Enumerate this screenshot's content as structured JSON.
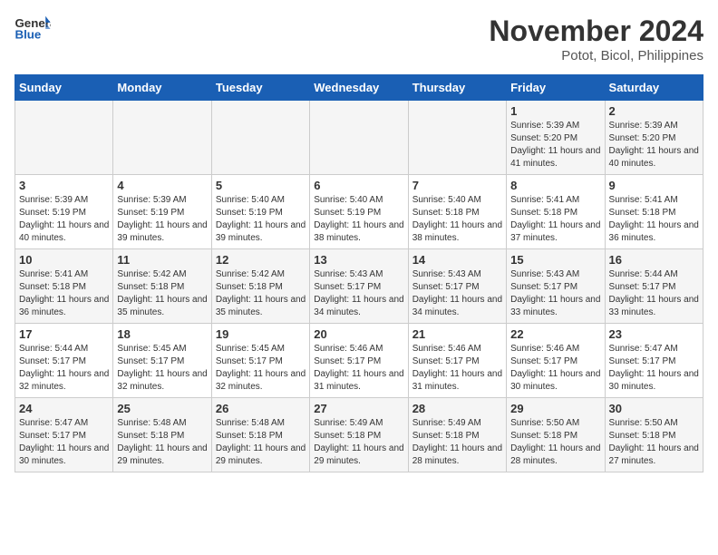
{
  "header": {
    "logo_line1": "General",
    "logo_line2": "Blue",
    "month": "November 2024",
    "location": "Potot, Bicol, Philippines"
  },
  "days_of_week": [
    "Sunday",
    "Monday",
    "Tuesday",
    "Wednesday",
    "Thursday",
    "Friday",
    "Saturday"
  ],
  "weeks": [
    [
      {
        "day": "",
        "info": ""
      },
      {
        "day": "",
        "info": ""
      },
      {
        "day": "",
        "info": ""
      },
      {
        "day": "",
        "info": ""
      },
      {
        "day": "",
        "info": ""
      },
      {
        "day": "1",
        "info": "Sunrise: 5:39 AM\nSunset: 5:20 PM\nDaylight: 11 hours and 41 minutes."
      },
      {
        "day": "2",
        "info": "Sunrise: 5:39 AM\nSunset: 5:20 PM\nDaylight: 11 hours and 40 minutes."
      }
    ],
    [
      {
        "day": "3",
        "info": "Sunrise: 5:39 AM\nSunset: 5:19 PM\nDaylight: 11 hours and 40 minutes."
      },
      {
        "day": "4",
        "info": "Sunrise: 5:39 AM\nSunset: 5:19 PM\nDaylight: 11 hours and 39 minutes."
      },
      {
        "day": "5",
        "info": "Sunrise: 5:40 AM\nSunset: 5:19 PM\nDaylight: 11 hours and 39 minutes."
      },
      {
        "day": "6",
        "info": "Sunrise: 5:40 AM\nSunset: 5:19 PM\nDaylight: 11 hours and 38 minutes."
      },
      {
        "day": "7",
        "info": "Sunrise: 5:40 AM\nSunset: 5:18 PM\nDaylight: 11 hours and 38 minutes."
      },
      {
        "day": "8",
        "info": "Sunrise: 5:41 AM\nSunset: 5:18 PM\nDaylight: 11 hours and 37 minutes."
      },
      {
        "day": "9",
        "info": "Sunrise: 5:41 AM\nSunset: 5:18 PM\nDaylight: 11 hours and 36 minutes."
      }
    ],
    [
      {
        "day": "10",
        "info": "Sunrise: 5:41 AM\nSunset: 5:18 PM\nDaylight: 11 hours and 36 minutes."
      },
      {
        "day": "11",
        "info": "Sunrise: 5:42 AM\nSunset: 5:18 PM\nDaylight: 11 hours and 35 minutes."
      },
      {
        "day": "12",
        "info": "Sunrise: 5:42 AM\nSunset: 5:18 PM\nDaylight: 11 hours and 35 minutes."
      },
      {
        "day": "13",
        "info": "Sunrise: 5:43 AM\nSunset: 5:17 PM\nDaylight: 11 hours and 34 minutes."
      },
      {
        "day": "14",
        "info": "Sunrise: 5:43 AM\nSunset: 5:17 PM\nDaylight: 11 hours and 34 minutes."
      },
      {
        "day": "15",
        "info": "Sunrise: 5:43 AM\nSunset: 5:17 PM\nDaylight: 11 hours and 33 minutes."
      },
      {
        "day": "16",
        "info": "Sunrise: 5:44 AM\nSunset: 5:17 PM\nDaylight: 11 hours and 33 minutes."
      }
    ],
    [
      {
        "day": "17",
        "info": "Sunrise: 5:44 AM\nSunset: 5:17 PM\nDaylight: 11 hours and 32 minutes."
      },
      {
        "day": "18",
        "info": "Sunrise: 5:45 AM\nSunset: 5:17 PM\nDaylight: 11 hours and 32 minutes."
      },
      {
        "day": "19",
        "info": "Sunrise: 5:45 AM\nSunset: 5:17 PM\nDaylight: 11 hours and 32 minutes."
      },
      {
        "day": "20",
        "info": "Sunrise: 5:46 AM\nSunset: 5:17 PM\nDaylight: 11 hours and 31 minutes."
      },
      {
        "day": "21",
        "info": "Sunrise: 5:46 AM\nSunset: 5:17 PM\nDaylight: 11 hours and 31 minutes."
      },
      {
        "day": "22",
        "info": "Sunrise: 5:46 AM\nSunset: 5:17 PM\nDaylight: 11 hours and 30 minutes."
      },
      {
        "day": "23",
        "info": "Sunrise: 5:47 AM\nSunset: 5:17 PM\nDaylight: 11 hours and 30 minutes."
      }
    ],
    [
      {
        "day": "24",
        "info": "Sunrise: 5:47 AM\nSunset: 5:17 PM\nDaylight: 11 hours and 30 minutes."
      },
      {
        "day": "25",
        "info": "Sunrise: 5:48 AM\nSunset: 5:18 PM\nDaylight: 11 hours and 29 minutes."
      },
      {
        "day": "26",
        "info": "Sunrise: 5:48 AM\nSunset: 5:18 PM\nDaylight: 11 hours and 29 minutes."
      },
      {
        "day": "27",
        "info": "Sunrise: 5:49 AM\nSunset: 5:18 PM\nDaylight: 11 hours and 29 minutes."
      },
      {
        "day": "28",
        "info": "Sunrise: 5:49 AM\nSunset: 5:18 PM\nDaylight: 11 hours and 28 minutes."
      },
      {
        "day": "29",
        "info": "Sunrise: 5:50 AM\nSunset: 5:18 PM\nDaylight: 11 hours and 28 minutes."
      },
      {
        "day": "30",
        "info": "Sunrise: 5:50 AM\nSunset: 5:18 PM\nDaylight: 11 hours and 27 minutes."
      }
    ]
  ]
}
